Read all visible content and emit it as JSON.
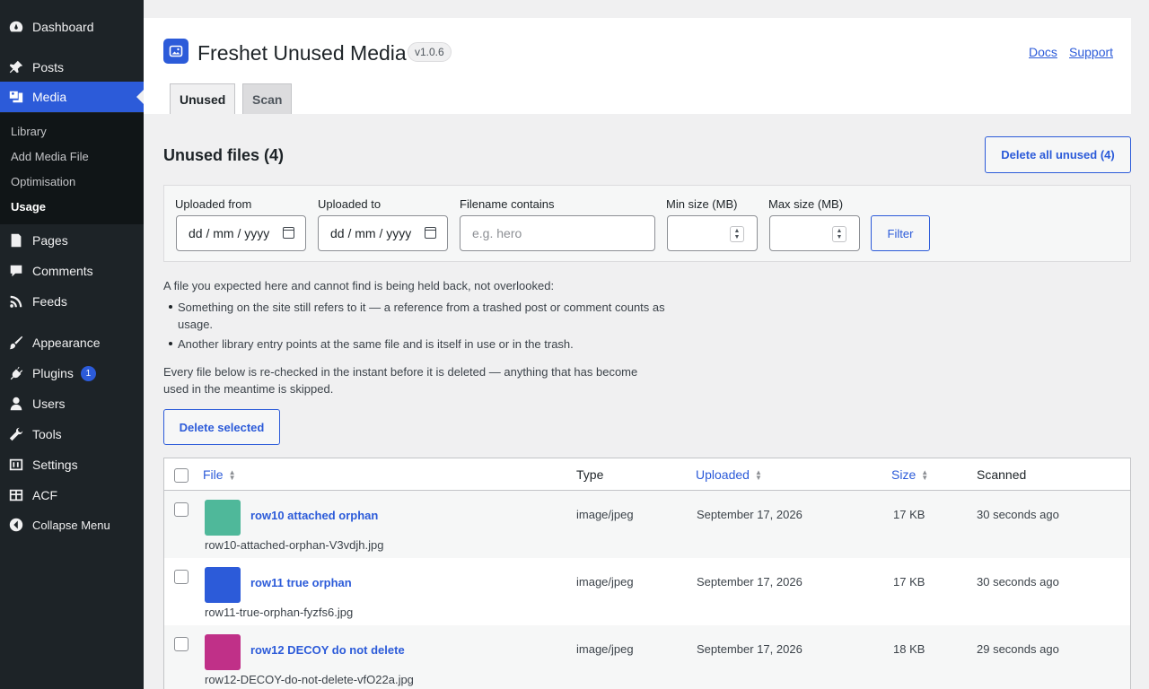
{
  "sidebar": {
    "items": [
      {
        "label": "Dashboard",
        "icon": "dashboard-icon"
      },
      {
        "label": "Posts",
        "icon": "pin-icon"
      },
      {
        "label": "Media",
        "icon": "media-icon"
      },
      {
        "label": "Pages",
        "icon": "page-icon"
      },
      {
        "label": "Comments",
        "icon": "comment-icon"
      },
      {
        "label": "Feeds",
        "icon": "rss-icon"
      },
      {
        "label": "Appearance",
        "icon": "brush-icon"
      },
      {
        "label": "Plugins",
        "icon": "plug-icon",
        "badge": "1"
      },
      {
        "label": "Users",
        "icon": "user-icon"
      },
      {
        "label": "Tools",
        "icon": "wrench-icon"
      },
      {
        "label": "Settings",
        "icon": "settings-icon"
      },
      {
        "label": "ACF",
        "icon": "grid-icon"
      },
      {
        "label": "Collapse Menu",
        "icon": "collapse-icon"
      }
    ],
    "submenu": [
      "Library",
      "Add Media File",
      "Optimisation",
      "Usage"
    ]
  },
  "header": {
    "title": "Freshet Unused Media",
    "version": "v1.0.6",
    "links": [
      "Docs",
      "Support"
    ],
    "tabs": [
      "Unused",
      "Scan"
    ]
  },
  "main": {
    "section_title": "Unused files (4)",
    "delete_all_label": "Delete all unused (4)",
    "filters": {
      "from_label": "Uploaded from",
      "from_value": "dd / mm / yyyy",
      "to_label": "Uploaded to",
      "to_value": "dd / mm / yyyy",
      "filename_label": "Filename contains",
      "filename_placeholder": "e.g. hero",
      "min_label": "Min size (MB)",
      "max_label": "Max size (MB)",
      "filter_button": "Filter"
    },
    "notice_intro": "A file you expected here and cannot find is being held back, not overlooked:",
    "notice_bullet1_line1": "Something on the site still refers to it — a reference from a trashed post or comment counts as",
    "notice_bullet1_line2": "usage.",
    "notice_bullet2": "Another library entry points at the same file and is itself in use or in the trash.",
    "notice_recheck_line1": "Every file below is re-checked in the instant before it is deleted — anything that has become",
    "notice_recheck_line2": "used in the meantime is skipped.",
    "delete_selected_label": "Delete selected"
  },
  "table": {
    "columns": {
      "file": "File",
      "type": "Type",
      "uploaded": "Uploaded",
      "size": "Size",
      "scanned": "Scanned"
    },
    "rows": [
      {
        "title": "row10 attached orphan",
        "filename": "row10-attached-orphan-V3vdjh.jpg",
        "type": "image/jpeg",
        "uploaded": "September 17, 2026",
        "size": "17 KB",
        "scanned": "30 seconds ago",
        "color": "#4fb89a"
      },
      {
        "title": "row11 true orphan",
        "filename": "row11-true-orphan-fyzfs6.jpg",
        "type": "image/jpeg",
        "uploaded": "September 17, 2026",
        "size": "17 KB",
        "scanned": "30 seconds ago",
        "color": "#2c5bd9"
      },
      {
        "title": "row12 DECOY do not delete",
        "filename": "row12-DECOY-do-not-delete-vfO22a.jpg",
        "type": "image/jpeg",
        "uploaded": "September 17, 2026",
        "size": "18 KB",
        "scanned": "29 seconds ago",
        "color": "#c03088"
      }
    ]
  }
}
